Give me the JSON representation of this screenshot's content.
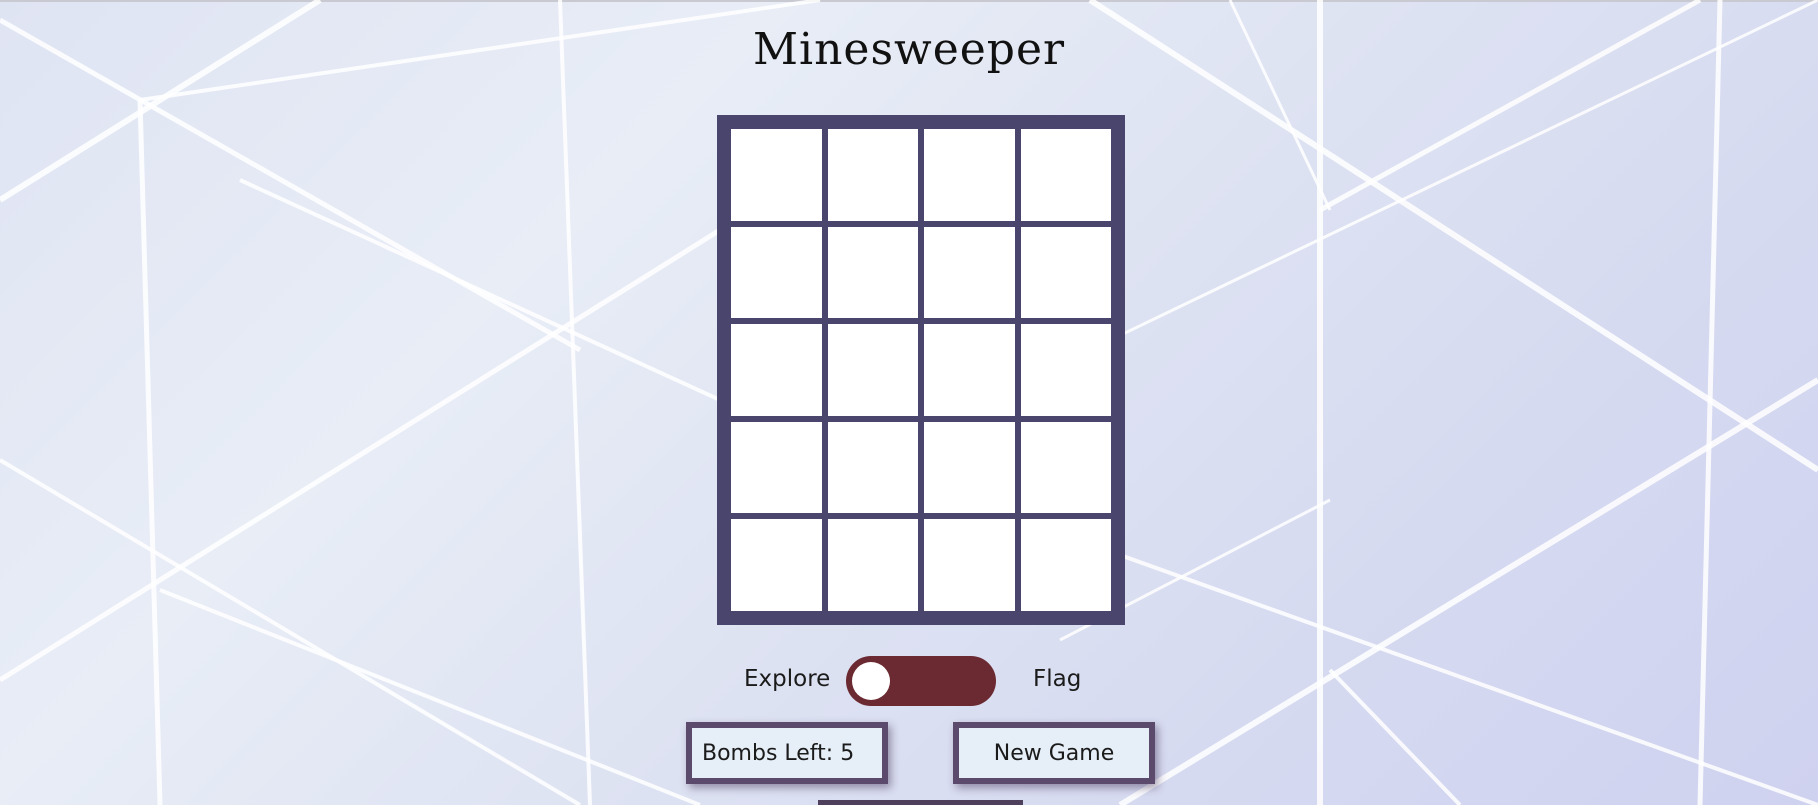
{
  "title": "Minesweeper",
  "board": {
    "columns": 4,
    "rows": 5,
    "cells": [
      [
        "",
        "",
        "",
        ""
      ],
      [
        "",
        "",
        "",
        ""
      ],
      [
        "",
        "",
        "",
        ""
      ],
      [
        "",
        "",
        "",
        ""
      ],
      [
        "",
        "",
        "",
        ""
      ]
    ],
    "frame_color": "#4a456c",
    "cell_color": "#ffffff"
  },
  "mode_toggle": {
    "left_label": "Explore",
    "right_label": "Flag",
    "selected": "Explore",
    "track_color": "#6b2a31"
  },
  "status": {
    "bombs_left_label": "Bombs Left: 5"
  },
  "actions": {
    "new_game_label": "New Game"
  }
}
